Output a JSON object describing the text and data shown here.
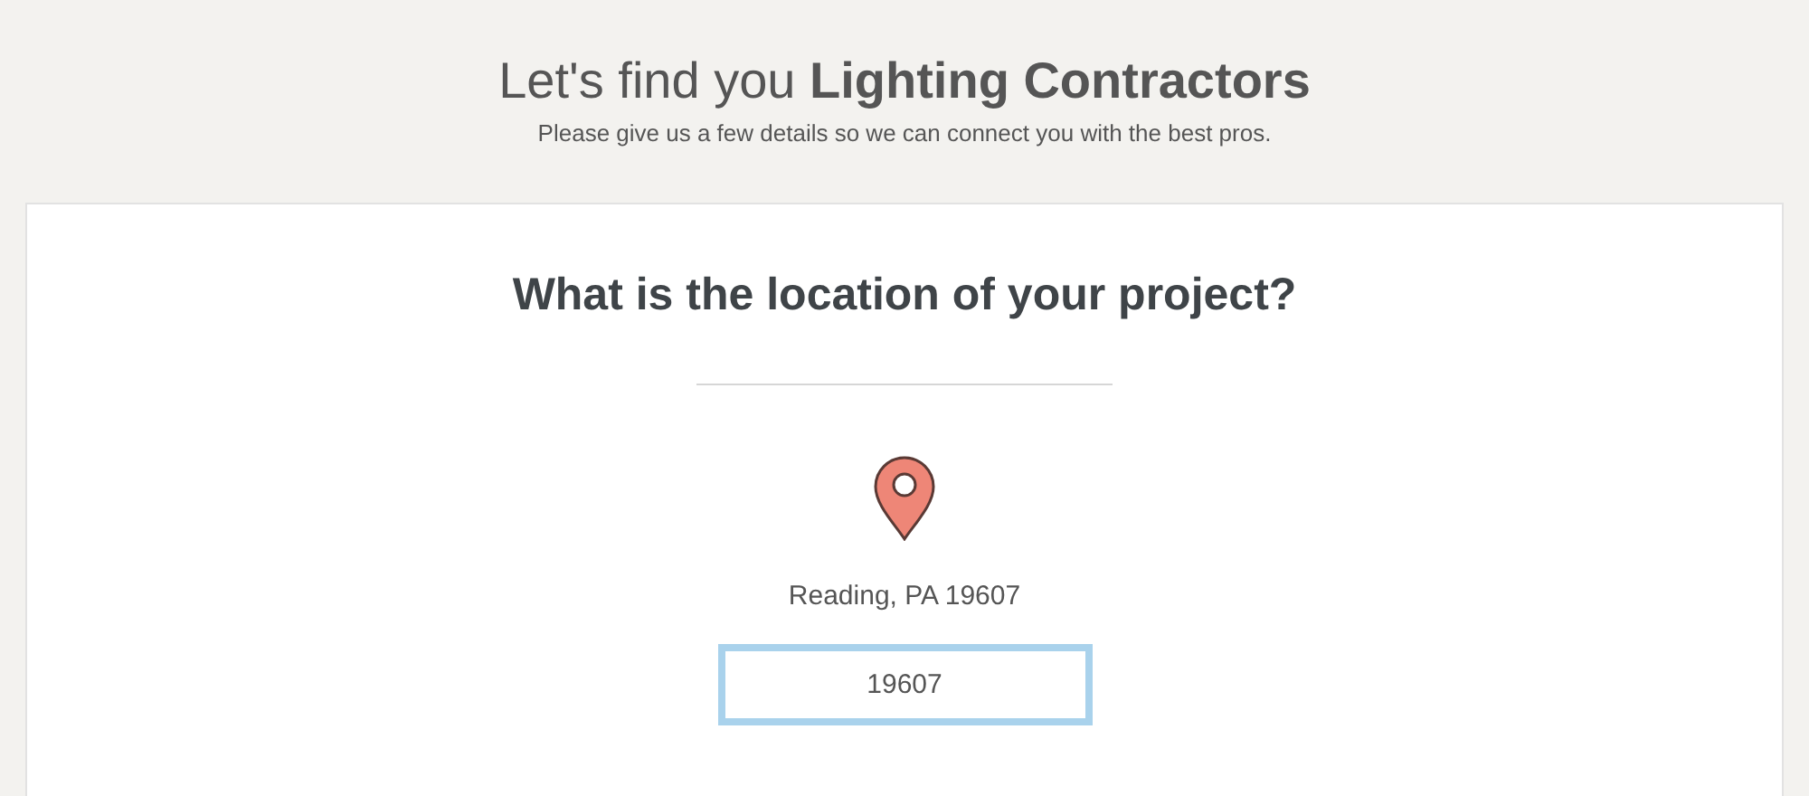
{
  "header": {
    "title": "Let's find you **Lighting Contractors**",
    "subtitle": "Please give us a few details so we can connect you with the best pros."
  },
  "card": {
    "question": "What is the location of your project?",
    "location": "Reading, PA 19607",
    "zip_field": {
      "value": "19607",
      "focused": true
    }
  }
}
